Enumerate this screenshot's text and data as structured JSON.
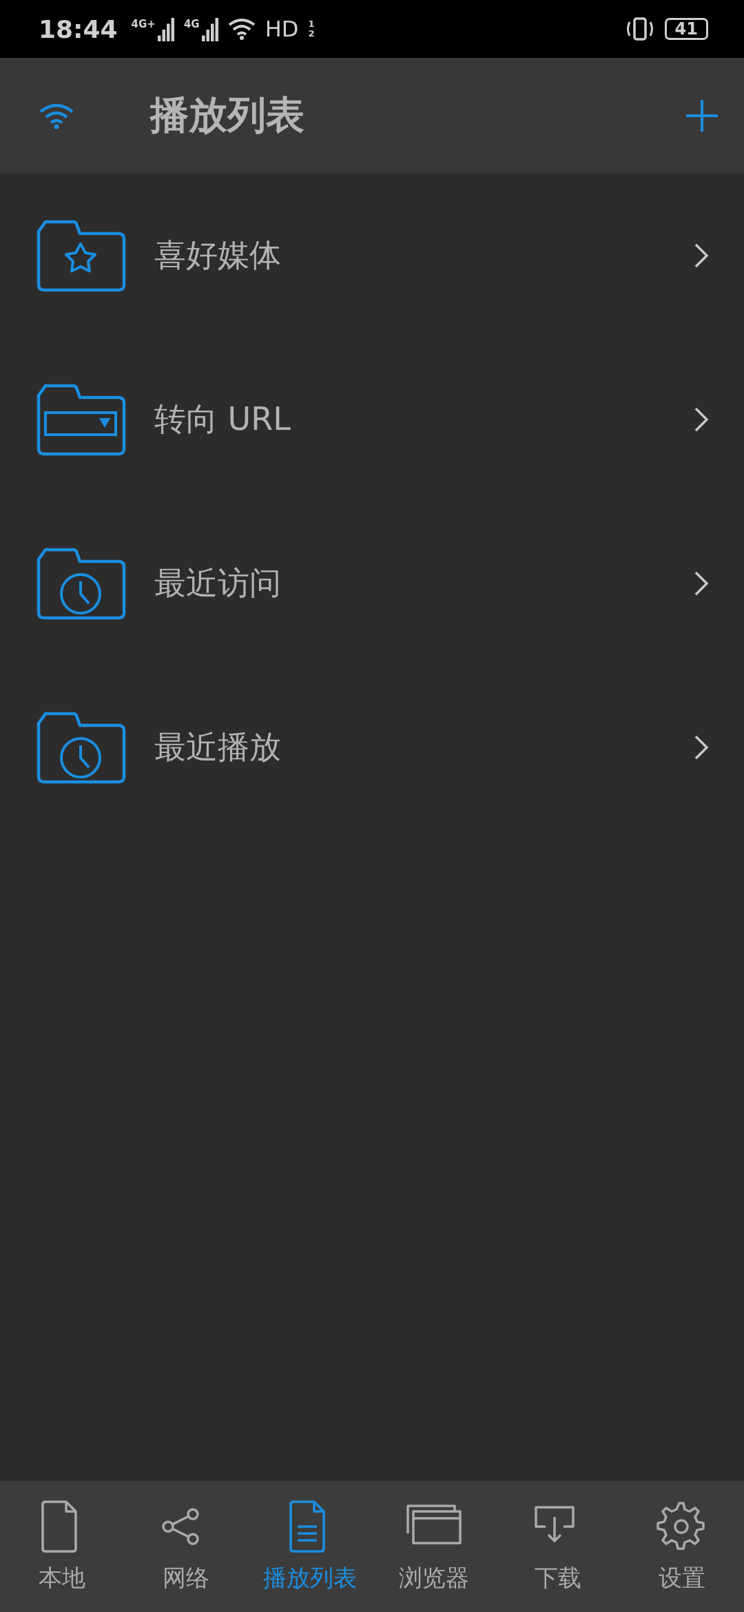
{
  "status_bar": {
    "time": "18:44",
    "signals": [
      {
        "label": "4G+"
      },
      {
        "label": "4G"
      }
    ],
    "hd": {
      "label": "HD",
      "sims": [
        "1",
        "2"
      ]
    },
    "battery": "41"
  },
  "header": {
    "title": "播放列表"
  },
  "items": [
    {
      "label": "喜好媒体",
      "kind": "star"
    },
    {
      "label": "转向 URL",
      "kind": "url"
    },
    {
      "label": "最近访问",
      "kind": "clock"
    },
    {
      "label": "最近播放",
      "kind": "clock"
    }
  ],
  "nav": [
    {
      "label": "本地",
      "kind": "file",
      "selected": false
    },
    {
      "label": "网络",
      "kind": "share",
      "selected": false
    },
    {
      "label": "播放列表",
      "kind": "doc",
      "selected": true
    },
    {
      "label": "浏览器",
      "kind": "windows",
      "selected": false
    },
    {
      "label": "下载",
      "kind": "download",
      "selected": false
    },
    {
      "label": "设置",
      "kind": "gear",
      "selected": false
    }
  ]
}
